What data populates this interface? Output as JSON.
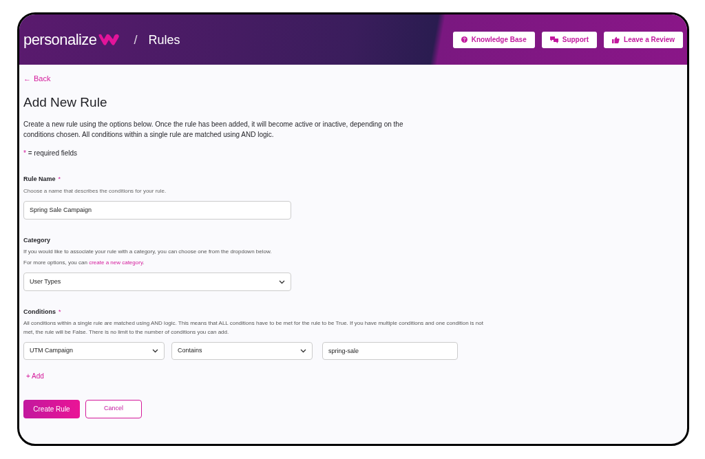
{
  "header": {
    "logo": "personalize",
    "separator": "/",
    "title": "Rules",
    "buttons": [
      {
        "kind": "help",
        "label": "Knowledge Base"
      },
      {
        "kind": "chat",
        "label": "Support"
      },
      {
        "kind": "thumb",
        "label": "Leave a Review"
      }
    ]
  },
  "back_link": {
    "arrow": "←",
    "label": "Back"
  },
  "heading": "Add New Rule",
  "intro": "Create a new rule using the options below. Once the rule has been added, it will become active or inactive, depending on the conditions chosen. All conditions within a single rule are matched using AND logic.",
  "required_legend": {
    "mark": "*",
    "text": "= required fields"
  },
  "rule_name": {
    "label": "Rule Name",
    "required_mark": "*",
    "hint": "Choose a name that describes the conditions for your rule.",
    "value": "Spring Sale Campaign"
  },
  "category": {
    "label": "Category",
    "hint": "If you would like to associate your rule with a category, you can choose one from the dropdown below.",
    "hint_2_before": "For more options, you can",
    "hint_2_link": "create a new category",
    "hint_2_after": ".",
    "value": "User Types"
  },
  "conditions": {
    "label": "Conditions",
    "required_mark": "*",
    "hint": "All conditions within a single rule are matched using AND logic. This means that ALL conditions have to be met for the rule to be True. If you have multiple conditions and one condition is not met, the rule will be False. There is no limit to the number of conditions you can add.",
    "rows": [
      [
        {
          "kind": "select",
          "value": "UTM Campaign"
        },
        {
          "kind": "select",
          "value": "Contains"
        },
        {
          "kind": "input",
          "value": "spring-sale"
        }
      ]
    ],
    "add_label": "+ Add"
  },
  "actions": {
    "primary": "Create Rule",
    "secondary": "Cancel"
  }
}
